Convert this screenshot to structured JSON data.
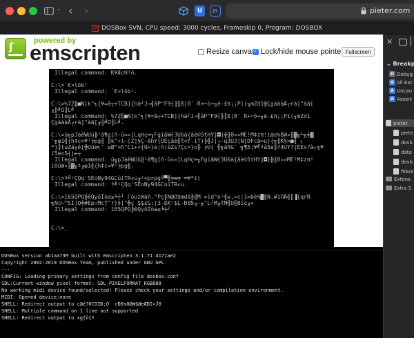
{
  "browser": {
    "url": "pieter.com",
    "tab_title": "DOSBox SVN, CPU speed: 3000 cycles, Frameskip 0, Program: DOSBOX"
  },
  "header": {
    "powered_by": "powered by",
    "brand": "emscripten",
    "resize_label": "Resize canvas",
    "resize_checked": false,
    "lock_label": "Lock/hide mouse pointer",
    "lock_checked": true,
    "fullscreen_label": "Fullscreen"
  },
  "dos_screen": {
    "lines": [
      {
        "t": " Illegal command: K¥ÆcH!ó.",
        "hi": false
      },
      {
        "t": "",
        "hi": false
      },
      {
        "t": "C:\\>`€¤lòb²",
        "hi": false
      },
      {
        "t": " Illegal command: `€¤lòb².",
        "hi": false
      },
      {
        "t": "",
        "hi": false
      },
      {
        "t": "C:\\>%7Z╣■N]k\"╕{¥=â┬+TCB]{hà┘J→╣âP\"F9┤╟║ß|Θ¯ R+⌐ó+╖é-£π¡¡Pï(╖mZd1╬ÇgàààÅ┌rà]\"àã[",
        "hi": false
      },
      {
        "t": "╓║╝Ω║L╝",
        "hi": false
      },
      {
        "t": " Illegal command: %7Z╣■N]k\"╕{¥=â┬+TCB]{hà┘J→╣âP\"F9┤╟║ß|Θ¯ R+⌐ó+╖é-£π¡¡Pï(╖mZd1",
        "hi": false
      },
      {
        "t": "ÇgàààÅ┌rà]\"àã[╓║╝Ω║L╝.",
        "hi": false
      },
      {
        "t": "",
        "hi": false
      },
      {
        "t": "C:\\>ü╗pJàêWUü╠²ã¶g[ñ-û≈»]LqHç═╖FgíãW╡3U6à{âè©5tHYj◘]╬║Θ»»ME!M‡zπ!ì@s%ßW»╟▓╗┴╗╪▓",
        "hi": false
      },
      {
        "t": "'╗φ1╣{h‡c=¥¹╞pg╢ ╟k\"+l—[Z]§Ç-éhY{ÜÉçâè╢ť<f-iT)╟╣J|┌-q3UJ|N[DFcà=uj{╗╢K§>■╢ ┐",
        "hi": false
      },
      {
        "t": "*}║tuZáyé[╬Uüe╕' ≥B™¤ñ\"C1+«{U«}e¦ñ(àZs?Çc>}o╟ ╒U{ ╣╗äñG¯ ╗¶5¦¥╝ªà5e╟?4UY?{ÉEx?à┐╗¥",
        "hi": false
      },
      {
        "t": "ï5e<5┤j►┬",
        "hi": false
      },
      {
        "t": " Illegal command: ü╗pJàêWUü╠²ã¶g[ñ-û≈»]LqHç═╖FgíãW╡3U6à{âè©5tHYj◘]╬║Θ»»ME!M‡zπ!",
        "hi": false
      },
      {
        "t": "ìOûW»╟▓╗ª╓φ1╣{h‡c=¥¹╞pg╢.",
        "hi": false
      },
      {
        "t": "",
        "hi": false
      },
      {
        "t": "C:\\>ª╝²ÇQq'SÉoNy94GCúíTR«u╓²<p=ρg╙▀╣╤≡╤ ═¥*ï(",
        "hi": false
      },
      {
        "t": " Illegal command: ª╝²ÇQq'SÉoNy94GCúíTR«u.",
        "hi": false
      },
      {
        "t": "",
        "hi": false
      },
      {
        "t": "C:\\>î65QPQ╠êQyôÎòa≤╘┼┘ ΓôüzWàñ.^Pç╢N@Ö$mdá╟╣M =ïd^o¹╣w,«c¦1=bè%█╢N.#1ΠÅ╣║▐{qrR",
        "hi": false
      },
      {
        "t": "╗Nc∟™SI]Q╪#Ep:Mcƒ\"r}§[\"╬ç Ş$¢G:|3-ßK¹$L-Ð05╓-╥\"L┘M╓TM╣U╢Bí¢╓«",
        "hi": false
      },
      {
        "t": " Illegal command: î65QPQ╠êQyôÎòa≤╘┼┘.",
        "hi": false
      },
      {
        "t": "",
        "hi": false
      },
      {
        "t": "",
        "hi": false
      },
      {
        "t": "C:\\>_",
        "hi": false
      }
    ]
  },
  "console": {
    "lines": [
      "DOSBox version ab1aa73M built with Emscripten 3.1.71 4171ae2",
      "Copyright 2002-2019 DOSBox Team, published under GNU GPL.",
      "---",
      "CONFIG: Loading primary settings from config file dosbox.conf",
      "SDL:Current window pixel format: SDL_PIXELFORMAT_RGB888",
      "No working midi device found/selected! Please check your settings and/or compilation environment.",
      "MIDI: Opened device:none",
      "SHELL: Redirect output to c@é?0COIÐ;O  cÐ0s0@W$@eÆDI>Ĵ0",
      "SHELL: Multiple command on 1 line not supported",
      "SHELL: Redirect output to xgƒû{ª"
    ]
  },
  "inspector": {
    "breakpoints_header": "Breakpoi",
    "breakpoints": [
      {
        "badge": "D",
        "label": "Debug"
      },
      {
        "badge": "A",
        "label": "All Exc"
      },
      {
        "badge": "A",
        "label": "Uncau"
      },
      {
        "badge": "A",
        "label": "Assert"
      }
    ],
    "tree": [
      {
        "label": "pieter.",
        "kind": "root"
      },
      {
        "label": "piete",
        "kind": "file"
      },
      {
        "label": "dosb",
        "kind": "file"
      },
      {
        "label": "data",
        "kind": "file"
      },
      {
        "label": "dosb",
        "kind": "file"
      },
      {
        "label": "fido3",
        "kind": "file"
      },
      {
        "label": "Extens",
        "kind": "folder"
      },
      {
        "label": "Extra S",
        "kind": "folder"
      }
    ]
  }
}
